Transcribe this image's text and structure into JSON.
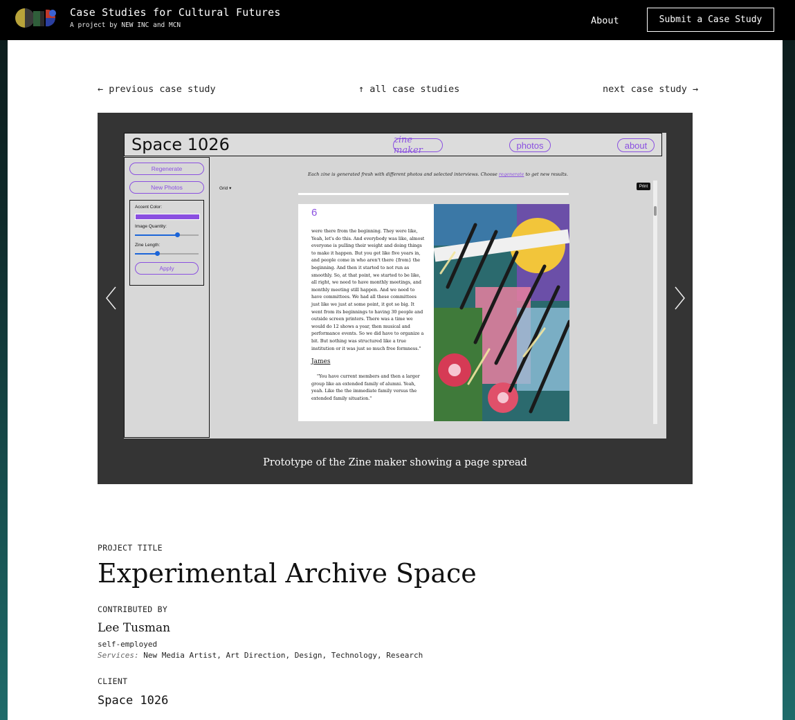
{
  "header": {
    "site_title": "Case Studies for Cultural Futures",
    "site_subtitle": "A project by NEW INC and MCN",
    "nav_about": "About",
    "submit_button": "Submit a Case Study"
  },
  "pagination": {
    "previous": "← previous case study",
    "all": "↑ all case studies",
    "next": "next case study →"
  },
  "slideshow": {
    "caption": "Prototype of the Zine maker showing a page spread",
    "screenshot": {
      "app_title": "Space 1026",
      "nav": [
        "zine maker",
        "photos",
        "about"
      ],
      "regenerate_button": "Regenerate",
      "new_photos_button": "New Photos",
      "accent_color_label": "Accent Color:",
      "accent_color": "#8a4fe0",
      "image_quantity_label": "Image Quantity:",
      "image_quantity_level": 0.66,
      "zine_length_label": "Zine Length:",
      "zine_length_level": 0.35,
      "apply_button": "Apply",
      "intro_before": "Each zine is generated fresh with different photos and selected interviews. Choose",
      "intro_link": "regenerate",
      "intro_after": "to get new results.",
      "grid_select": "Grid ▾",
      "print_button": "Print",
      "page_number": "6",
      "body_text": "were there from the beginning. They were like, Yeah, let's do this. And everybody was like, almost everyone is pulling their weight and doing things to make it happen. But you get like five years in, and people come in who aren't there {from} the beginning. And then it started to not run as smoothly. So, at that point, we started to be like, all right, we need to have monthly meetings, and monthly meeting still happen. And we need to have committees. We had all these committees just like we just at some point, it got so big. It went from its beginnings to having 30 people and outside screen printers. There was a time we would do 12 shows a year, then musical and performance events. So we did have to organize a bit. But nothing was structured like a true institution or it was just so much free formness.\"",
      "speaker": "James",
      "quote": "\"You have current members and then a larger group like an extended family of alumni. Yeah, yeah. Like the the immediate family versus the extended family situation.\""
    }
  },
  "project": {
    "title_label": "PROJECT TITLE",
    "title": "Experimental Archive Space",
    "contributed_label": "CONTRIBUTED BY",
    "contributor": "Lee Tusman",
    "employment": "self-employed",
    "services_label": "Services:",
    "services": "New Media Artist, Art Direction, Design, Technology, Research",
    "client_label": "CLIENT",
    "client": "Space 1026"
  }
}
